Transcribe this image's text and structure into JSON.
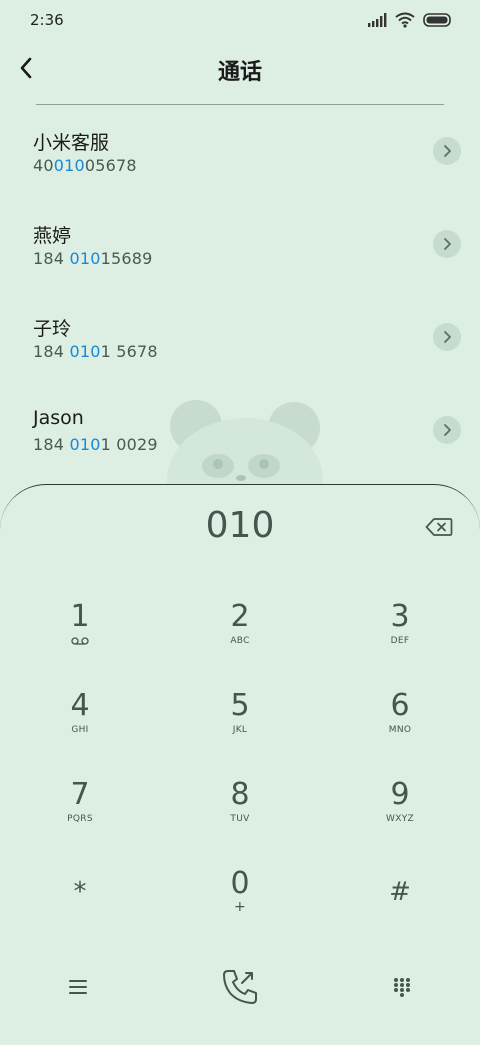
{
  "status": {
    "time": "2:36"
  },
  "header": {
    "title": "通话"
  },
  "contacts": [
    {
      "name": "小米客服",
      "num_pre": "40",
      "num_hl": "010",
      "num_post": "05678"
    },
    {
      "name": "燕婷",
      "num_pre": "184 ",
      "num_hl": "010",
      "num_post": "15689"
    },
    {
      "name": "子玲",
      "num_pre": "184 ",
      "num_hl": "010",
      "num_post": "1 5678"
    },
    {
      "name": "Jason",
      "num_pre": "184 ",
      "num_hl": "010",
      "num_post": "1 0029"
    }
  ],
  "dialpad": {
    "entered": "010",
    "keys": [
      {
        "digit": "1",
        "letters": ""
      },
      {
        "digit": "2",
        "letters": "ABC"
      },
      {
        "digit": "3",
        "letters": "DEF"
      },
      {
        "digit": "4",
        "letters": "GHI"
      },
      {
        "digit": "5",
        "letters": "JKL"
      },
      {
        "digit": "6",
        "letters": "MNO"
      },
      {
        "digit": "7",
        "letters": "PQRS"
      },
      {
        "digit": "8",
        "letters": "TUV"
      },
      {
        "digit": "9",
        "letters": "WXYZ"
      },
      {
        "digit": "*",
        "letters": ""
      },
      {
        "digit": "0",
        "letters": "+"
      },
      {
        "digit": "#",
        "letters": ""
      }
    ]
  },
  "colors": {
    "background": "#dcefe2",
    "highlight": "#1a88d6",
    "text": "#46554f"
  }
}
